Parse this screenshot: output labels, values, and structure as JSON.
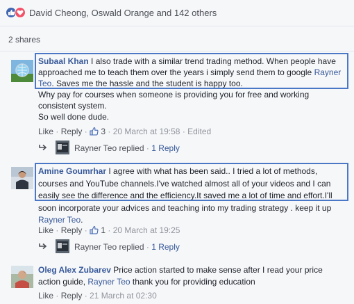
{
  "reactions": {
    "names": "David Cheong, Oswald Orange and 142 others"
  },
  "shares": "2 shares",
  "comments": [
    {
      "author": "Subaal Khan",
      "text_before_link": " I also trade with a similar trend trading method. When people have approached me to teach them over the years i simply send them to google ",
      "link": "Rayner Teo",
      "text_after_link": ". Saves me the hassle and the student is happy too.",
      "line_a": "Why pay for courses when someone is providing you for free and working consistent system.",
      "line_b": "So well done dude.",
      "like": "Like",
      "reply": "Reply",
      "reaction_count": "3",
      "timestamp": "20 March at 19:58",
      "edited": "Edited",
      "reply_author": "Rayner Teo replied",
      "reply_count": "1 Reply"
    },
    {
      "author": "Amine Goumrhar",
      "text_before_link": " I agree with what has been said.. I tried a lot of methods, courses and YouTube channels.I've watched almost all of your videos and I can easily see the difference and the efficiency.It saved me a lot of time and effort.I'll soon incorporate your advices and teaching into my trading strategy . keep it up ",
      "link": "Rayner Teo",
      "text_after_link": ".",
      "like": "Like",
      "reply": "Reply",
      "reaction_count": "1",
      "timestamp": "20 March at 19:25",
      "reply_author": "Rayner Teo replied",
      "reply_count": "1 Reply"
    },
    {
      "author": "Oleg Alex Zubarev",
      "text_before_link": " Price action started to make sense after I read your price action guide, ",
      "link": "Rayner Teo",
      "text_after_link": " thank you for providing education",
      "like": "Like",
      "reply": "Reply",
      "timestamp": "21 March at 02:30"
    }
  ],
  "separators": {
    "dot": " · "
  }
}
